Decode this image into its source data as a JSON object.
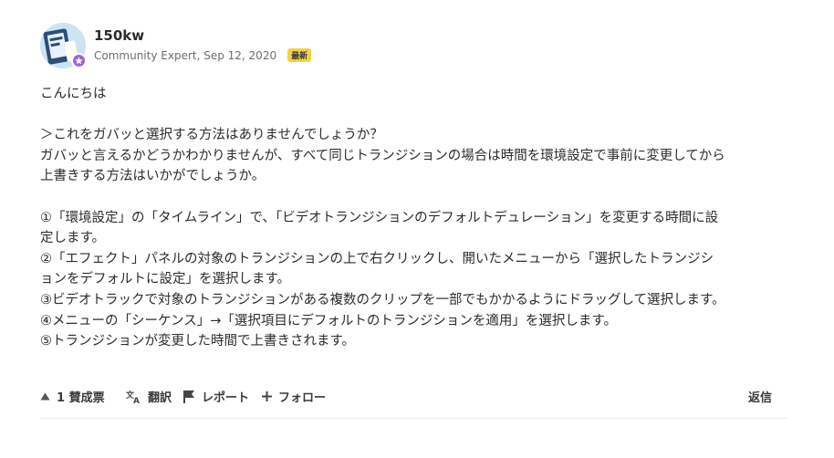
{
  "post": {
    "author": "150kw",
    "role_date": "Community Expert, Sep 12, 2020",
    "badge": "最新",
    "body_lines": [
      "こんにちは",
      "",
      "＞これをガバッと選択する方法はありませんでしょうか？",
      "ガバッと言えるかどうかわかりませんが、すべて同じトランジションの場合は時間を環境設定で事前に変更してから",
      "上書きする方法はいかがでしょうか。",
      "",
      "①「環境設定」の「タイムライン」で、「ビデオトランジションのデフォルトデュレーション」を変更する時間に設",
      "定します。",
      "②「エフェクト」パネルの対象のトランジションの上で右クリックし、開いたメニューから「選択したトランジシ",
      "ョンをデフォルトに設定」を選択します。",
      "③ビデオトラックで対象のトランジションがある複数のクリップを一部でもかかるようにドラッグして選択します。",
      "④メニューの「シーケンス」→「選択項目にデフォルトのトランジションを適用」を選択します。",
      "⑤トランジションが変更した時間で上書きされます。"
    ]
  },
  "actions": {
    "upvote": "1 賛成票",
    "translate": "翻訳",
    "report": "レポート",
    "follow": "フォロー",
    "reply": "返信"
  },
  "icons": {
    "avatar": "avatar-image",
    "expert": "star-icon",
    "upvote": "triangle-up-icon",
    "translate": "translate-icon",
    "report": "flag-icon",
    "follow": "plus-icon"
  },
  "colors": {
    "badge_bg": "#f0d248",
    "expert_badge": "#a064d8",
    "text": "#2c2c2c",
    "meta": "#6e6e6e"
  }
}
